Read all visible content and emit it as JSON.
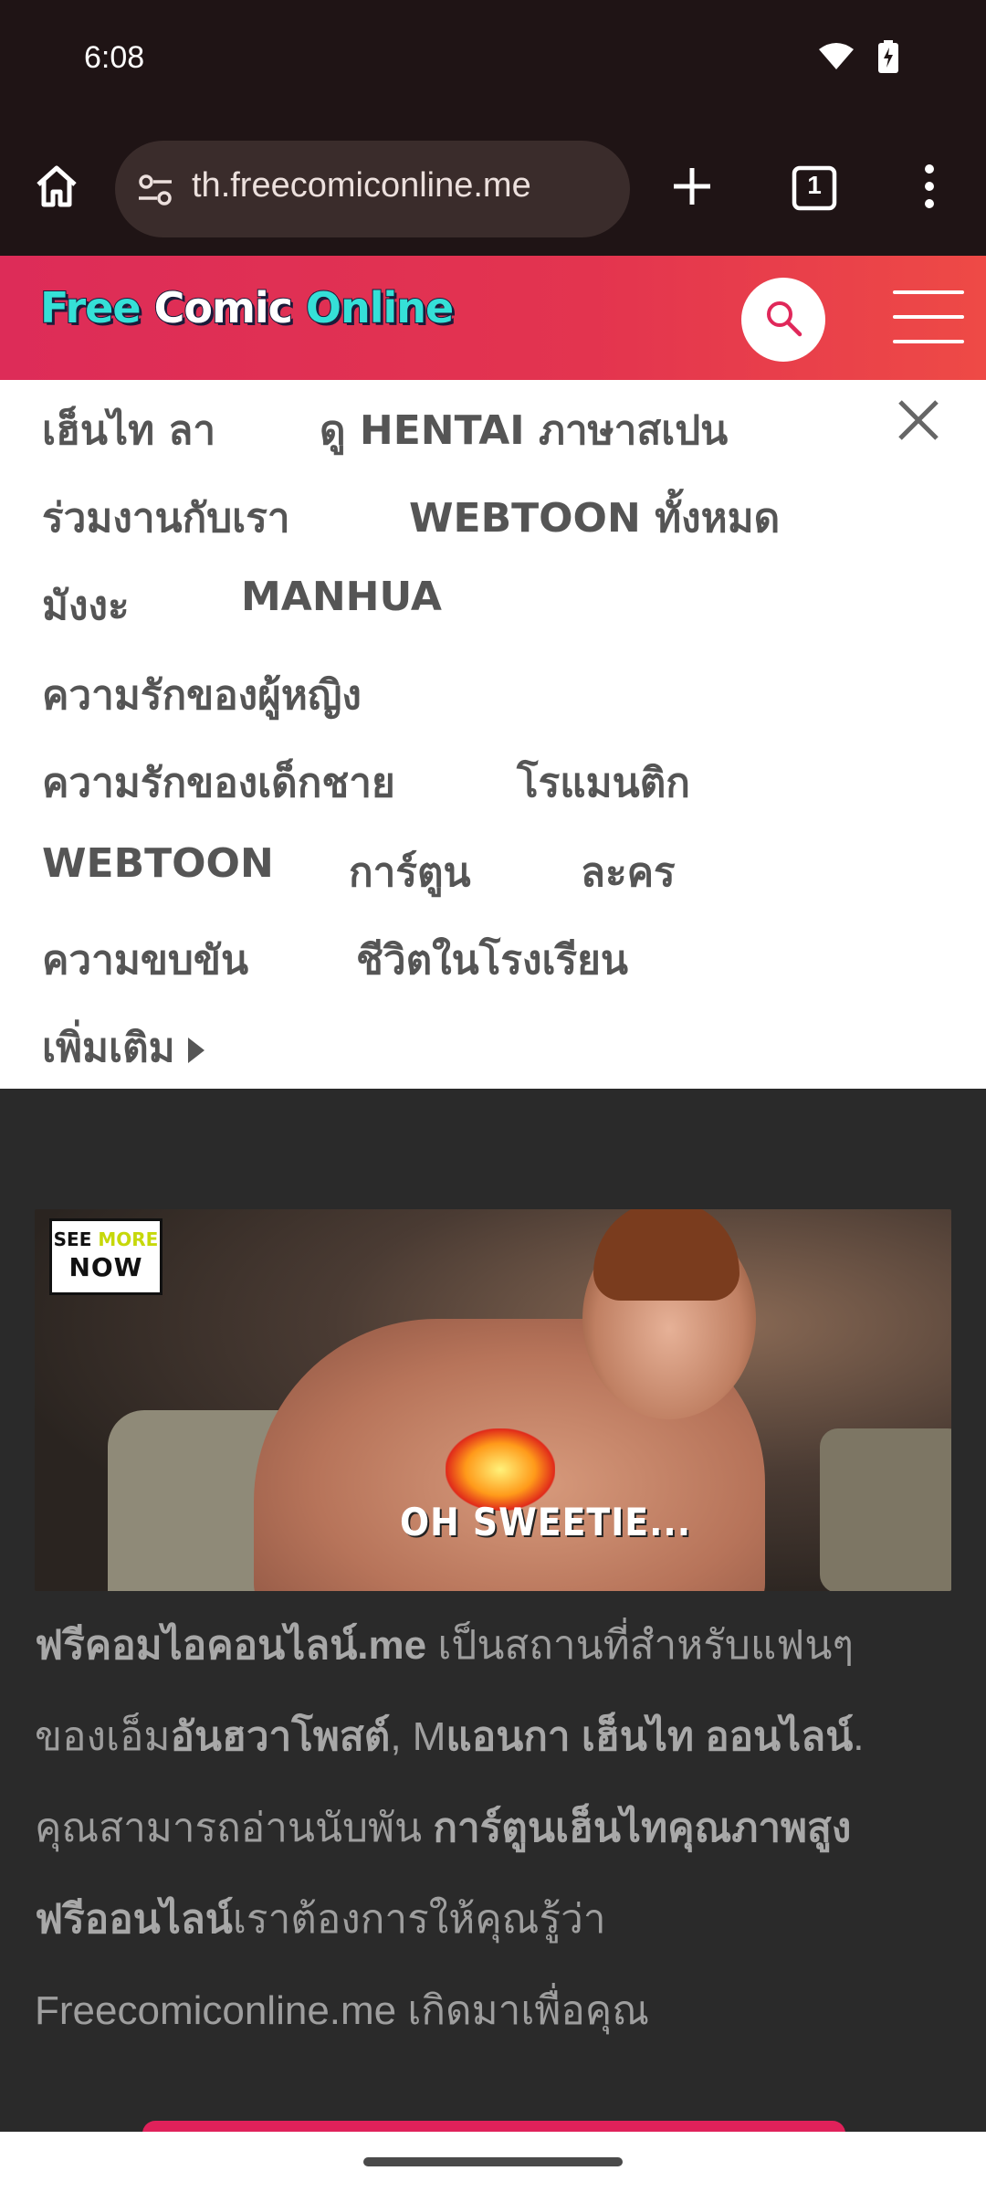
{
  "status": {
    "time": "6:08",
    "icons": [
      "wifi-icon",
      "battery-charging-icon"
    ]
  },
  "browser": {
    "url": "th.freecomiconline.me",
    "tab_count": "1",
    "buttons": [
      "home-icon",
      "site-settings-icon",
      "new-tab-icon",
      "tab-switcher-icon",
      "overflow-menu-icon"
    ]
  },
  "site": {
    "logo_words": [
      "Free",
      "Comic",
      "Online"
    ],
    "header_color_start": "#dd2c58",
    "header_color_end": "#ee4a46"
  },
  "nav": {
    "items": [
      "เฮ็นไท ลา",
      "ดู HENTAI ภาษาสเปน",
      "ร่วมงานกับเรา",
      "WEBTOON ทั้งหมด",
      "มังงะ",
      "MANHUA",
      "ความรักของผู้หญิง",
      "ความรักของเด็กชาย",
      "โรแมนติก",
      "WEBTOON",
      "การ์ตูน",
      "ละคร",
      "ความขบขัน",
      "ชีวิตในโรงเรียน"
    ],
    "more_label": "เพิ่มเติม"
  },
  "ad": {
    "badge_line1_a": "SEE",
    "badge_line1_b": "MORE",
    "badge_line2": "NOW",
    "caption": "OH SWEETIE..."
  },
  "description": {
    "p1_bold": "ฟรีคอมไอคอนไลน์.me",
    "p1_rest": " เป็นสถานที่สำหรับแฟนๆ",
    "p2_pre": "ของเอ็ม",
    "p2_bold1": "อันฮวาโพสต์",
    "p2_mid": ", M",
    "p2_bold2": "แอนกา เฮ็นไท ออนไลน์",
    "p2_end": ".",
    "p3_pre": "คุณสามารถอ่านนับพัน ",
    "p3_bold": "การ์ตูนเฮ็นไทคุณภาพสูง",
    "p4_bold": "ฟรีออนไลน์",
    "p4_rest": "เราต้องการให้คุณรู้ว่า",
    "p5": "Freecomiconline.me เกิดมาเพื่อคุณ"
  }
}
